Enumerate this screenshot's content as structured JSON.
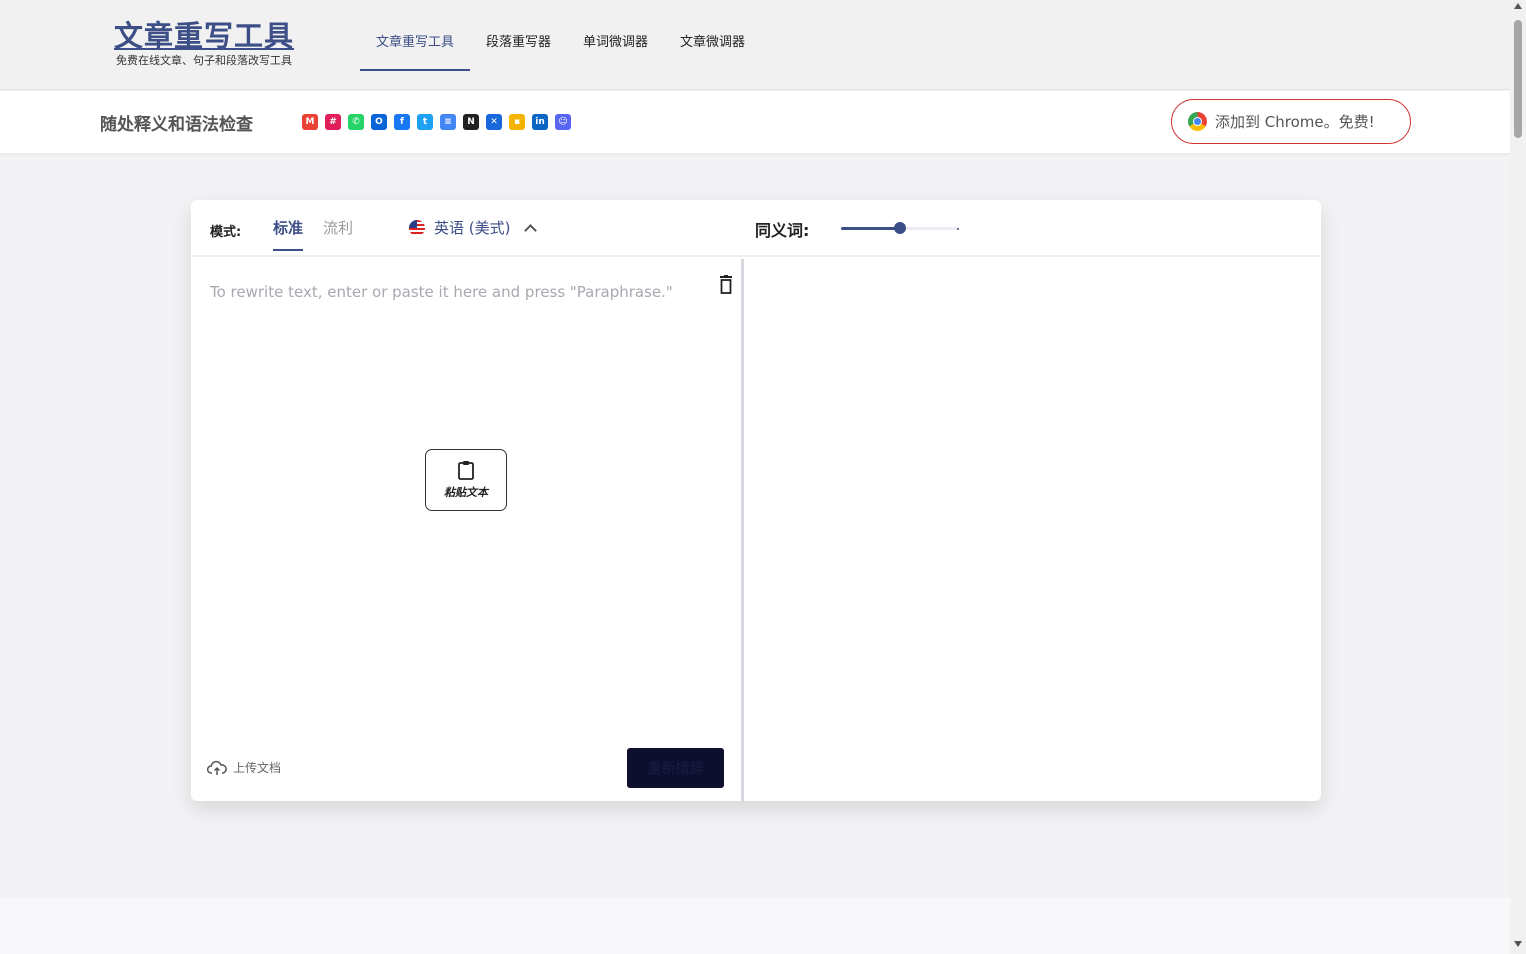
{
  "header": {
    "logo_title": "文章重写工具",
    "logo_subtitle": "免费在线文章、句子和段落改写工具",
    "nav": [
      {
        "label": "文章重写工具",
        "active": true
      },
      {
        "label": "段落重写器",
        "active": false
      },
      {
        "label": "单词微调器",
        "active": false
      },
      {
        "label": "文章微调器",
        "active": false
      }
    ]
  },
  "promo": {
    "title": "随处释义和语法检查",
    "apps": [
      {
        "icon": "gmail-icon",
        "glyph": "M",
        "color": "#ea4335"
      },
      {
        "icon": "slack-icon",
        "glyph": "#",
        "color": "#e01e5a"
      },
      {
        "icon": "whatsapp-icon",
        "glyph": "✆",
        "color": "#25d366"
      },
      {
        "icon": "outlook-icon",
        "glyph": "O",
        "color": "#0a64d6"
      },
      {
        "icon": "facebook-icon",
        "glyph": "f",
        "color": "#1877f2"
      },
      {
        "icon": "twitter-icon",
        "glyph": "t",
        "color": "#1da1f2"
      },
      {
        "icon": "google-docs-icon",
        "glyph": "≡",
        "color": "#4285f4"
      },
      {
        "icon": "notion-icon",
        "glyph": "N",
        "color": "#222222"
      },
      {
        "icon": "confluence-icon",
        "glyph": "✕",
        "color": "#1868db"
      },
      {
        "icon": "google-keep-icon",
        "glyph": "▪",
        "color": "#f4b400"
      },
      {
        "icon": "linkedin-icon",
        "glyph": "in",
        "color": "#0a66c2"
      },
      {
        "icon": "discord-icon",
        "glyph": "☺",
        "color": "#5865f2"
      }
    ],
    "chrome_button": "添加到 Chrome。免费!"
  },
  "editor": {
    "mode_label": "模式:",
    "modes": [
      {
        "label": "标准",
        "active": true
      },
      {
        "label": "流利",
        "active": false
      }
    ],
    "language": "英语 (美式)",
    "synonyms_label": "同义词:",
    "synonyms_level": 0.5,
    "input_placeholder": "To rewrite text, enter or paste it here and press \"Paraphrase.\"",
    "paste_button": "粘贴文本",
    "upload_label": "上传文档",
    "paraphrase_button": "重新措辞"
  },
  "colors": {
    "accent": "#3c4f86",
    "chrome_border": "#d23535",
    "button_dark": "#0e0e2e"
  }
}
